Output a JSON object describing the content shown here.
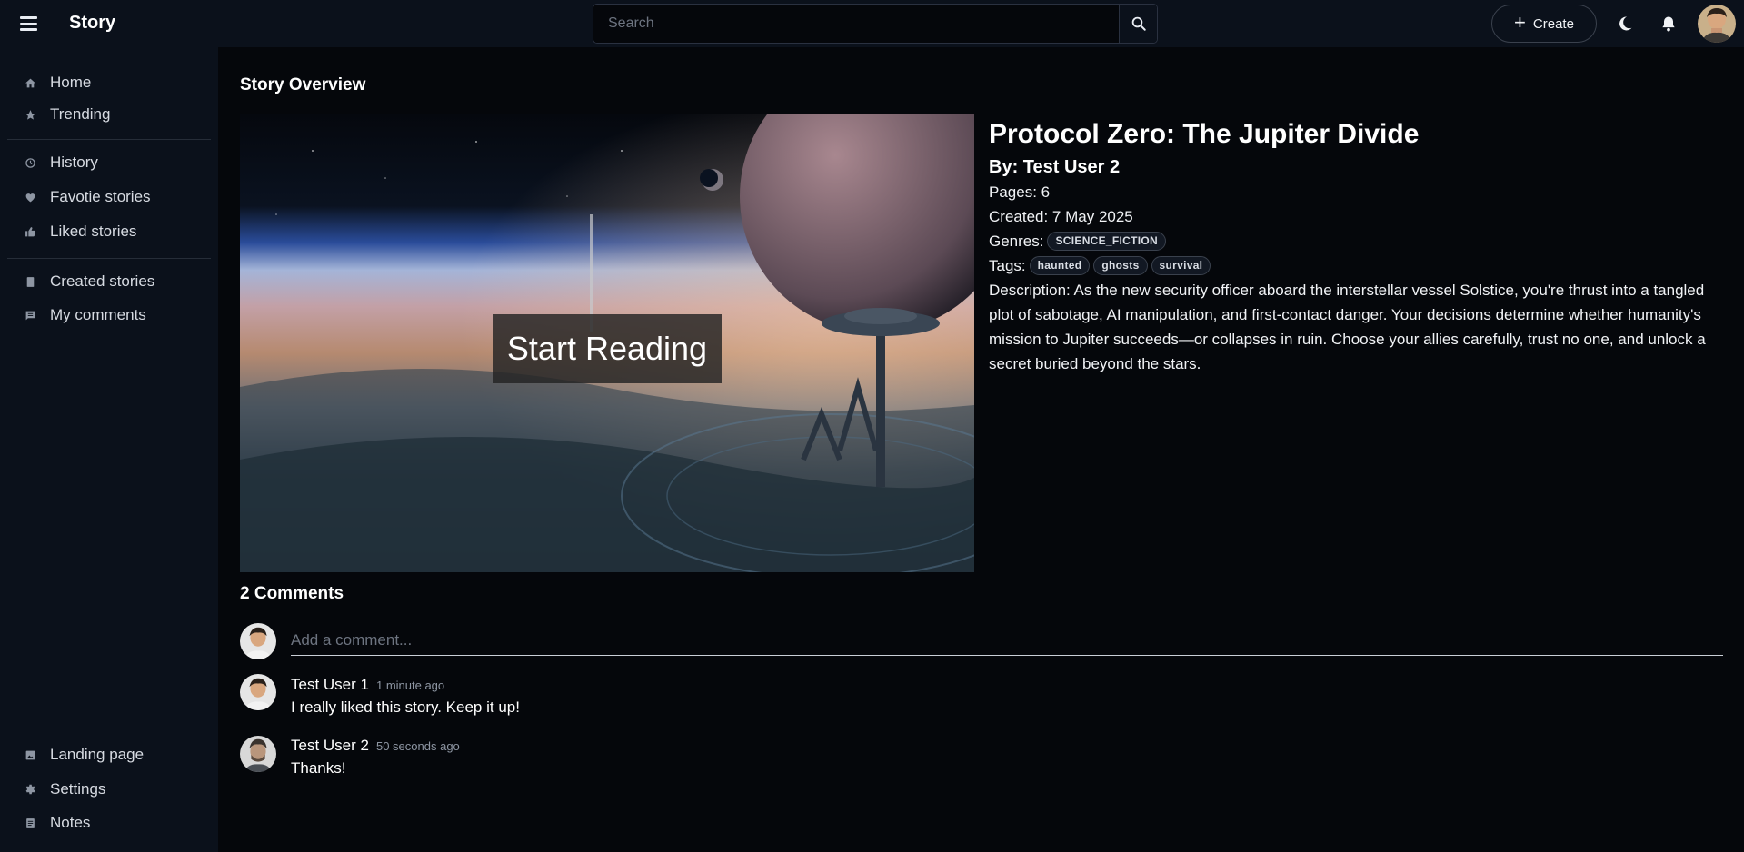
{
  "app": {
    "title": "Story"
  },
  "search": {
    "placeholder": "Search"
  },
  "header": {
    "create_label": "Create"
  },
  "sidebar": {
    "group1": [
      {
        "label": "Home",
        "icon": "home-icon"
      },
      {
        "label": "Trending",
        "icon": "star-icon"
      }
    ],
    "group2": [
      {
        "label": "History",
        "icon": "history-icon"
      },
      {
        "label": "Favotie stories",
        "icon": "heart-icon"
      },
      {
        "label": "Liked stories",
        "icon": "thumbs-up-icon"
      }
    ],
    "group3": [
      {
        "label": "Created stories",
        "icon": "book-icon"
      },
      {
        "label": "My comments",
        "icon": "comment-icon"
      }
    ],
    "bottom": [
      {
        "label": "Landing page",
        "icon": "image-icon"
      },
      {
        "label": "Settings",
        "icon": "gear-icon"
      },
      {
        "label": "Notes",
        "icon": "notes-icon"
      }
    ]
  },
  "overview": {
    "section_title": "Story Overview",
    "start_reading": "Start Reading",
    "title": "Protocol Zero: The Jupiter Divide",
    "author": "By: Test User 2",
    "pages": "Pages: 6",
    "created": "Created: 7 May 2025",
    "genres_label": "Genres:",
    "genres": [
      "SCIENCE_FICTION"
    ],
    "tags_label": "Tags:",
    "tags": [
      "haunted",
      "ghosts",
      "survival"
    ],
    "description": "Description: As the new security officer aboard the interstellar vessel Solstice, you're thrust into a tangled plot of sabotage, AI manipulation, and first-contact danger. Your decisions determine whether humanity's mission to Jupiter succeeds—or collapses in ruin. Choose your allies carefully, trust no one, and unlock a secret buried beyond the stars."
  },
  "comments": {
    "title": "2 Comments",
    "placeholder": "Add a comment...",
    "items": [
      {
        "author": "Test User 1",
        "time": "1 minute ago",
        "text": "I really liked this story. Keep it up!"
      },
      {
        "author": "Test User 2",
        "time": "50 seconds ago",
        "text": "Thanks!"
      }
    ]
  },
  "colors": {
    "background": "#05070b",
    "sidebar": "#0b111b",
    "text": "#e9edf3",
    "muted": "#8e96a3"
  }
}
